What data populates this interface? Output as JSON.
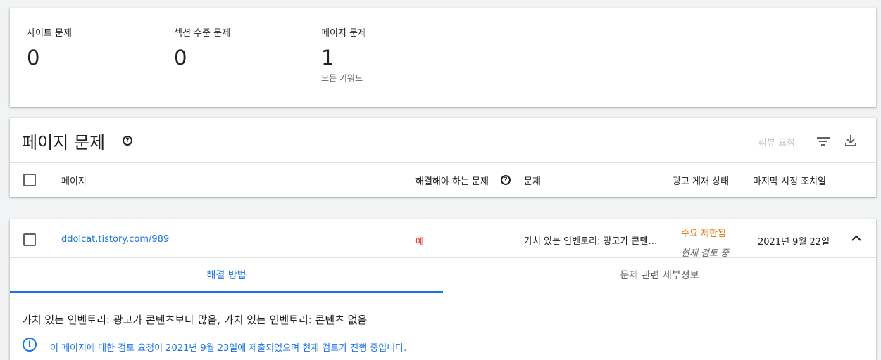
{
  "summary": {
    "site_label": "사이트 문제",
    "site_value": "0",
    "section_label": "섹션 수준 문제",
    "section_value": "0",
    "page_label": "페이지 문제",
    "page_value": "1",
    "page_sub": "모든 키워드"
  },
  "issues": {
    "title": "페이지 문제",
    "review_label": "리뷰 요청",
    "columns": {
      "page": "페이지",
      "must_fix": "해결해야 하는 문제",
      "issue": "문제",
      "ad_status": "광고 게재 상태",
      "last_action": "마지막 시정 조치일"
    }
  },
  "row": {
    "url": "ddolcat.tistory.com/989",
    "must_fix": "예",
    "issue": "가치 있는 인벤토리: 광고가 콘텐…",
    "status": "수요 제한됨",
    "status_sub": "현재 검토 중",
    "date": "2021년 9월 22일",
    "tabs": [
      "해결 방법",
      "문제 관련 세부정보"
    ],
    "description": "가치 있는 인벤토리: 광고가 콘텐츠보다 많음, 가치 있는 인벤토리: 콘텐츠 없음",
    "notice": "이 페이지에 대한 검토 요청이 2021년 9월 23일에 제출되었으며 현재 검토가 진행 중입니다."
  },
  "colors": {
    "accent": "#1a73e8",
    "warning": "#e37400",
    "danger": "#d93025"
  }
}
